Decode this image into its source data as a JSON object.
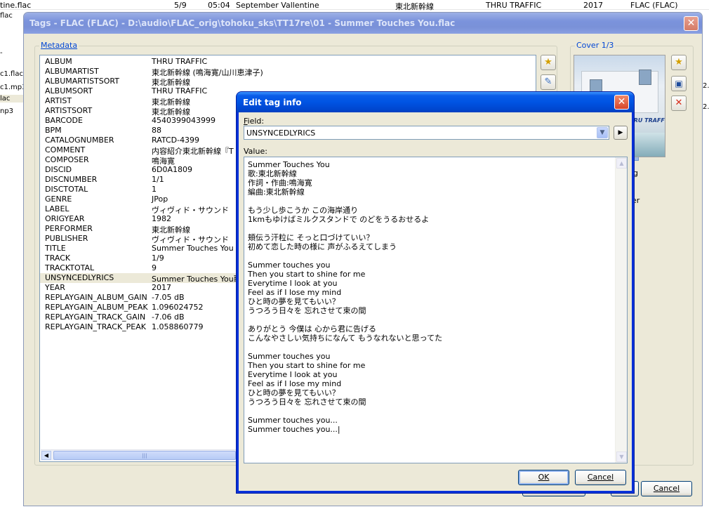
{
  "background": {
    "row": {
      "file": "tine.flac",
      "track": "5/9",
      "duration": "05:04",
      "title": "September Vallentine",
      "artist": "東北新幹線",
      "album": "THRU TRAFFIC",
      "year": "2017",
      "format": "FLAC (FLAC)"
    },
    "left_items": [
      "flac",
      "",
      "-",
      "",
      "c1.flac",
      "c1.mp3",
      "lac",
      "np3"
    ],
    "right_items": [
      "2.",
      "2."
    ]
  },
  "tags_window": {
    "title": "Tags - FLAC (FLAC) - D:\\audio\\FLAC_orig\\tohoku_sks\\TT17re\\01 - Summer Touches You.flac",
    "close_label": "✕",
    "metadata_label": "Metadata",
    "cover_label": "Cover 1/3",
    "cover_brand": "HRU TRAFFIC",
    "partial_text_1": "g",
    "partial_text_2": "er",
    "cancel_label": "Cancel",
    "rows": [
      {
        "k": "ALBUM",
        "v": "THRU TRAFFIC"
      },
      {
        "k": "ALBUMARTIST",
        "v": "東北新幹線 (鳴海寛/山川恵津子)"
      },
      {
        "k": "ALBUMARTISTSORT",
        "v": "東北新幹線"
      },
      {
        "k": "ALBUMSORT",
        "v": "THRU TRAFFIC"
      },
      {
        "k": "ARTIST",
        "v": "東北新幹線"
      },
      {
        "k": "ARTISTSORT",
        "v": "東北新幹線"
      },
      {
        "k": "BARCODE",
        "v": "4540399043999"
      },
      {
        "k": "BPM",
        "v": "88"
      },
      {
        "k": "CATALOGNUMBER",
        "v": "RATCD-4399"
      },
      {
        "k": "COMMENT",
        "v": "内容紹介東北新幹線『T"
      },
      {
        "k": "COMPOSER",
        "v": "鳴海寛"
      },
      {
        "k": "DISCID",
        "v": "6D0A1809"
      },
      {
        "k": "DISCNUMBER",
        "v": "1/1"
      },
      {
        "k": "DISCTOTAL",
        "v": "1"
      },
      {
        "k": "GENRE",
        "v": "JPop"
      },
      {
        "k": "LABEL",
        "v": "ヴィヴィド・サウンド"
      },
      {
        "k": "ORIGYEAR",
        "v": "1982"
      },
      {
        "k": "PERFORMER",
        "v": "東北新幹線"
      },
      {
        "k": "PUBLISHER",
        "v": "ヴィヴィド・サウンド"
      },
      {
        "k": "TITLE",
        "v": "Summer Touches You"
      },
      {
        "k": "TRACK",
        "v": "1/9"
      },
      {
        "k": "TRACKTOTAL",
        "v": "9"
      },
      {
        "k": "UNSYNCEDLYRICS",
        "v": "Summer Touches You歌:"
      },
      {
        "k": "YEAR",
        "v": "2017"
      },
      {
        "k": "REPLAYGAIN_ALBUM_GAIN",
        "v": "-7.05 dB"
      },
      {
        "k": "REPLAYGAIN_ALBUM_PEAK",
        "v": "1.096024752"
      },
      {
        "k": "REPLAYGAIN_TRACK_GAIN",
        "v": "-7.06 dB"
      },
      {
        "k": "REPLAYGAIN_TRACK_PEAK",
        "v": "1.058860779"
      }
    ]
  },
  "edit_dialog": {
    "title": "Edit tag info",
    "close_label": "✕",
    "field_label": "Field:",
    "field_value": "UNSYNCEDLYRICS",
    "value_label": "Value:",
    "lyrics": [
      "Summer Touches You",
      "歌:東北新幹線",
      "作詞・作曲:鳴海寛",
      "編曲:東北新幹線",
      "",
      "もう少し歩こうか この海岸通り",
      "1kmもゆけばミルクスタンドで のどをうるおせるよ",
      "",
      "頬伝う汗粒に そっと口づけていい？",
      "初めて恋した時の様に 声がふるえてしまう",
      "",
      "Summer touches you",
      "Then you start to shine for me",
      "Everytime I look at you",
      "Feel as if I lose my mind",
      "ひと時の夢を見てもいい？",
      "うつろう日々を 忘れさせて束の間",
      "",
      "ありがとう 今僕は 心から君に告げる",
      "こんなやさしい気持ちになんて もうなれないと思ってた",
      "",
      "Summer touches you",
      "Then you start to shine for me",
      "Everytime I look at you",
      "Feel as if I lose my mind",
      "ひと時の夢を見てもいい？",
      "うつろう日々を 忘れさせて束の間",
      "",
      "Summer touches you...",
      "Summer touches you...|"
    ],
    "ok_label": "OK",
    "cancel_label": "Cancel"
  }
}
